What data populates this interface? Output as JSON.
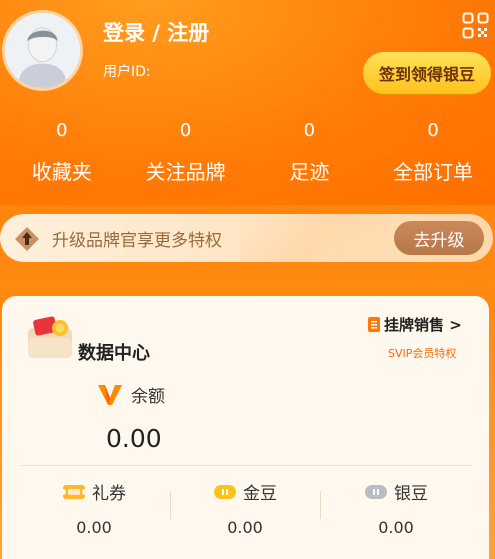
{
  "header": {
    "login_label": "登录 / 注册",
    "user_id_label": "用户ID:",
    "signin_button": "签到领得银豆"
  },
  "stats": [
    {
      "value": "0",
      "label": "收藏夹"
    },
    {
      "value": "0",
      "label": "关注品牌"
    },
    {
      "value": "0",
      "label": "足迹"
    },
    {
      "value": "0",
      "label": "全部订单"
    }
  ],
  "upgrade": {
    "text": "升级品牌官享更多特权",
    "button": "去升级"
  },
  "data_center": {
    "title": "数据中心",
    "listing_link": "挂牌销售 >",
    "svip_note": "SVIP会员特权",
    "balance_label": "余额",
    "balance_value": "0.00",
    "assets": [
      {
        "label": "礼券",
        "value": "0.00"
      },
      {
        "label": "金豆",
        "value": "0.00"
      },
      {
        "label": "银豆",
        "value": "0.00"
      }
    ]
  },
  "colors": {
    "header_orange": "#ff7a05",
    "signin_yellow": "#ffd23a",
    "upgrade_brown": "#b87748",
    "card_bg": "#fff8ee",
    "svip_orange": "#ff6a00"
  }
}
